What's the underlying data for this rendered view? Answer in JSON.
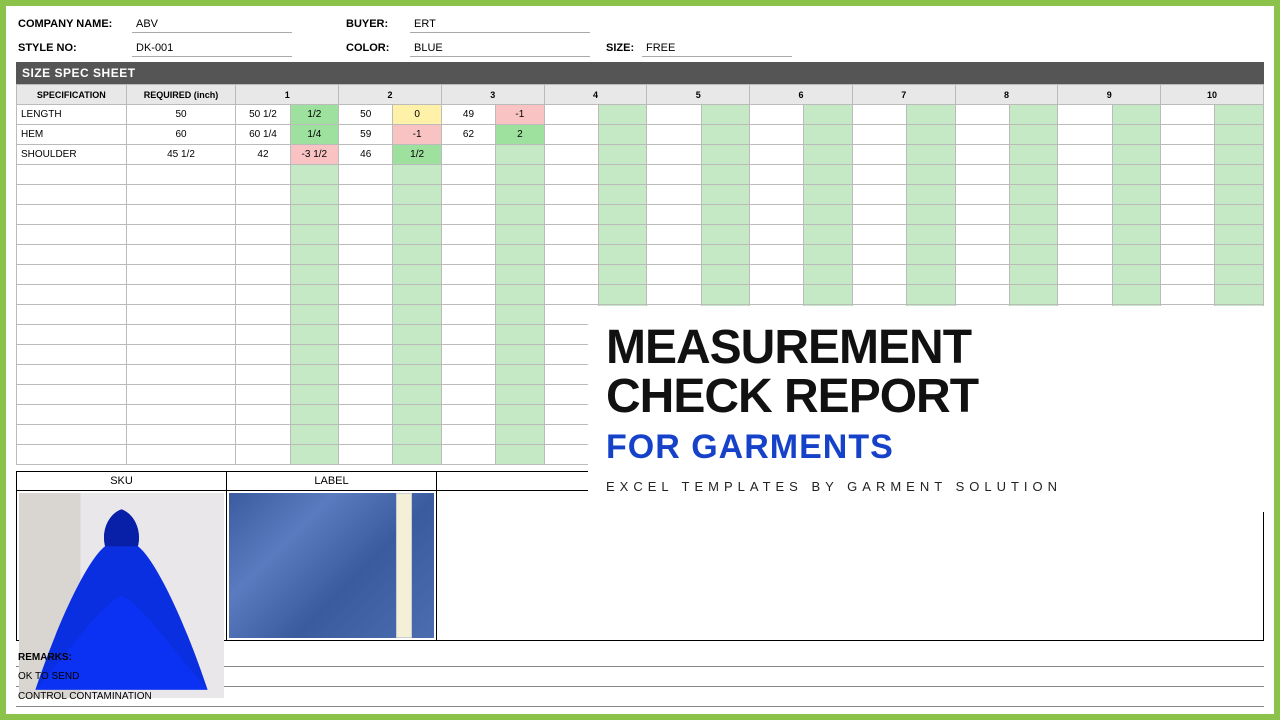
{
  "header": {
    "company_label": "COMPANY NAME:",
    "company": "ABV",
    "buyer_label": "BUYER:",
    "buyer": "ERT",
    "style_label": "STYLE NO:",
    "style": "DK-001",
    "color_label": "COLOR:",
    "color": "BLUE",
    "size_label": "SIZE:",
    "size": "FREE"
  },
  "banner": "SIZE SPEC SHEET",
  "columns": {
    "spec": "SPECIFICATION",
    "req": "REQUIRED (inch)",
    "samples": [
      "1",
      "2",
      "3",
      "4",
      "5",
      "6",
      "7",
      "8",
      "9",
      "10"
    ]
  },
  "rows": [
    {
      "spec": "LENGTH",
      "required": "50",
      "m": [
        "50 1/2",
        "50",
        "49",
        "",
        "",
        "",
        "",
        "",
        "",
        ""
      ],
      "d": [
        "1/2",
        "0",
        "-1",
        "",
        "",
        "",
        "",
        "",
        "",
        ""
      ],
      "dcolor": [
        "green",
        "yellow",
        "red",
        "plain",
        "plain",
        "plain",
        "plain",
        "plain",
        "plain",
        "plain"
      ]
    },
    {
      "spec": "HEM",
      "required": "60",
      "m": [
        "60 1/4",
        "59",
        "62",
        "",
        "",
        "",
        "",
        "",
        "",
        ""
      ],
      "d": [
        "1/4",
        "-1",
        "2",
        "",
        "",
        "",
        "",
        "",
        "",
        ""
      ],
      "dcolor": [
        "green",
        "red",
        "green",
        "plain",
        "plain",
        "plain",
        "plain",
        "plain",
        "plain",
        "plain"
      ]
    },
    {
      "spec": "SHOULDER",
      "required": "45 1/2",
      "m": [
        "42",
        "46",
        "",
        "",
        "",
        "",
        "",
        "",
        "",
        ""
      ],
      "d": [
        "-3 1/2",
        "1/2",
        "",
        "",
        "",
        "",
        "",
        "",
        "",
        ""
      ],
      "dcolor": [
        "red",
        "green",
        "plain",
        "plain",
        "plain",
        "plain",
        "plain",
        "plain",
        "plain",
        "plain"
      ]
    }
  ],
  "empty_row_count": 15,
  "photos": {
    "sku": "SKU",
    "label": "LABEL"
  },
  "remarks": {
    "title": "REMARKS:",
    "lines": [
      "OK TO SEND",
      "CONTROL CONTAMINATION"
    ]
  },
  "overlay": {
    "line1": "MEASUREMENT",
    "line2": "CHECK REPORT",
    "line3": "FOR GARMENTS",
    "line4": "EXCEL TEMPLATES BY GARMENT SOLUTION"
  }
}
